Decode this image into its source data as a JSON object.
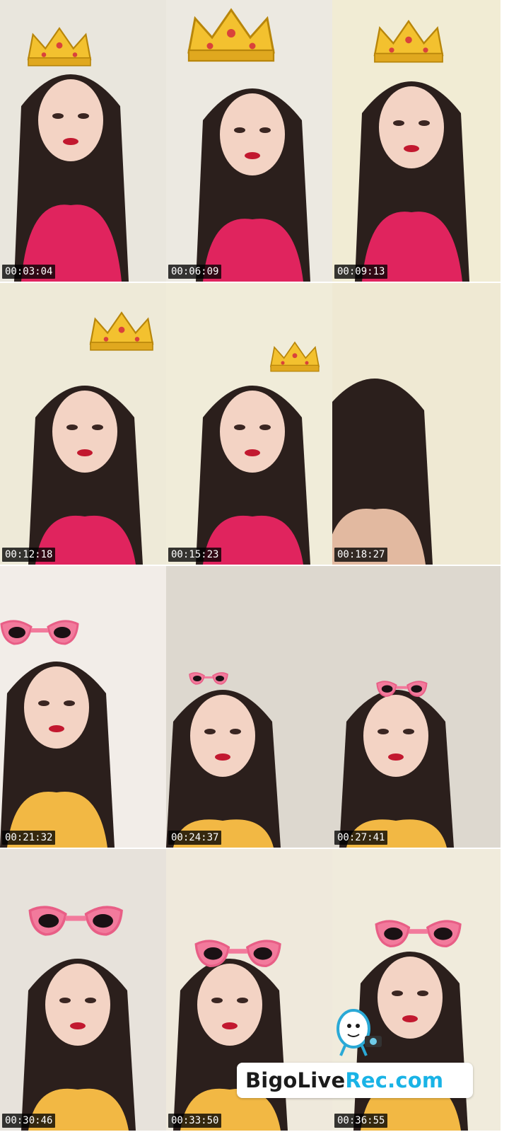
{
  "frames": [
    {
      "time": "00:03:04",
      "overlay": "crown-icon",
      "outfit": "pink-top"
    },
    {
      "time": "00:06:09",
      "overlay": "crown-icon",
      "outfit": "pink-top"
    },
    {
      "time": "00:09:13",
      "overlay": "crown-icon",
      "outfit": "pink-top"
    },
    {
      "time": "00:12:18",
      "overlay": "crown-icon",
      "outfit": "pink-top"
    },
    {
      "time": "00:15:23",
      "overlay": "crown-icon",
      "outfit": "pink-top"
    },
    {
      "time": "00:18:27",
      "overlay": "none",
      "outfit": "hair-closeup"
    },
    {
      "time": "00:21:32",
      "overlay": "pink-glasses-icon",
      "outfit": "yellow-top"
    },
    {
      "time": "00:24:37",
      "overlay": "pink-glasses-icon",
      "outfit": "yellow-top"
    },
    {
      "time": "00:27:41",
      "overlay": "pink-glasses-icon",
      "outfit": "yellow-top"
    },
    {
      "time": "00:30:46",
      "overlay": "pink-glasses-icon",
      "outfit": "yellow-top"
    },
    {
      "time": "00:33:50",
      "overlay": "pink-glasses-icon",
      "outfit": "yellow-top"
    },
    {
      "time": "00:36:55",
      "overlay": "pink-glasses-icon",
      "outfit": "yellow-top"
    }
  ],
  "watermark": {
    "part1": "BigoLive",
    "part2": "Rec.com",
    "icon": "bigo-mascot-icon"
  },
  "colors": {
    "top_pink": "#e0245e",
    "top_yellow": "#f2b844",
    "hair": "#2b1f1c",
    "crown": "#f3c12f",
    "glasses": "#f27a9c"
  }
}
